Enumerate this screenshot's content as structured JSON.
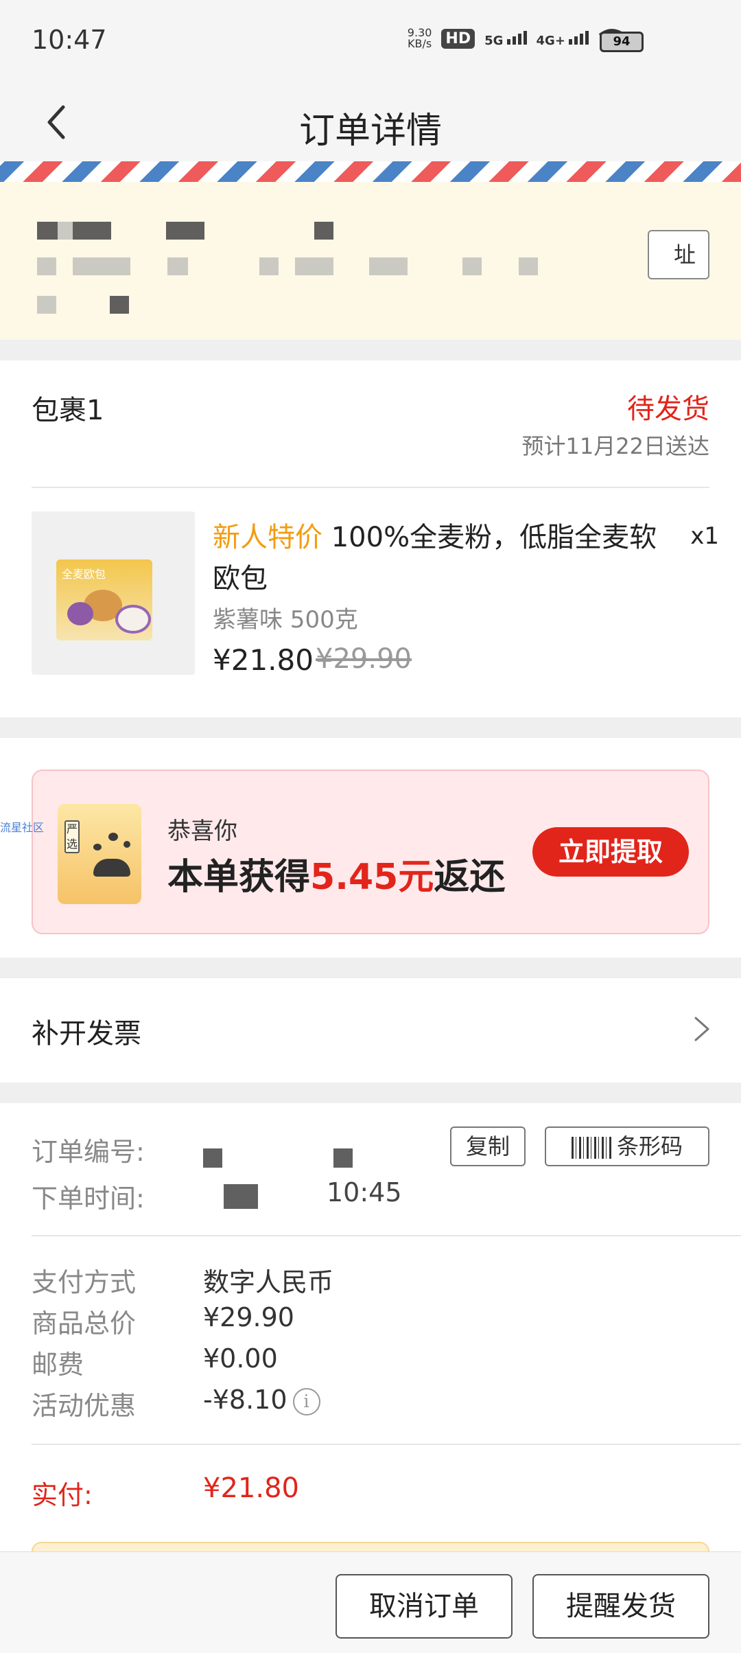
{
  "status_bar": {
    "time": "10:47",
    "speed_value": "9.30",
    "speed_unit": "KB/s",
    "hd": "HD",
    "net_5g": "5G",
    "net_4g": "4G+",
    "battery": "94",
    "icons": [
      "hd-icon",
      "signal-5g-icon",
      "signal-4g-icon",
      "wifi-icon",
      "battery-icon"
    ]
  },
  "nav": {
    "title": "订单详情",
    "back_icon": "chevron-left-icon"
  },
  "address": {
    "button_label": "址"
  },
  "package": {
    "title": "包裹1",
    "status": "待发货",
    "eta": "预计11月22日送达",
    "status_color": "#e1251b"
  },
  "product": {
    "tag": "新人特价",
    "name": "100%全麦粉，低脂全麦软欧包",
    "quantity": "x1",
    "spec": "紫薯味 500克",
    "price": "¥21.80",
    "original_price": "¥29.90",
    "image_text": "全麦欧包"
  },
  "promo": {
    "greeting": "恭喜你",
    "main_prefix": "本单获得",
    "amount": "5.45元",
    "main_suffix": "返还",
    "button_label": "立即提取",
    "logo_text": "严选",
    "side_watermark": "流星社区"
  },
  "invoice": {
    "label": "补开发票"
  },
  "order_info": {
    "order_no_label": "订单编号:",
    "order_time_label": "下单时间:",
    "order_time_value": "10:45",
    "copy_label": "复制",
    "barcode_label": "条形码"
  },
  "payment": {
    "rows": [
      {
        "label": "支付方式",
        "value": "数字人民币"
      },
      {
        "label": "商品总价",
        "value": "¥29.90"
      },
      {
        "label": "邮费",
        "value": "¥0.00"
      },
      {
        "label": "活动优惠",
        "value": "-¥8.10"
      }
    ],
    "info_icon": "i",
    "paid_label": "实付:",
    "paid_value": "¥21.80"
  },
  "bottom": {
    "cancel_label": "取消订单",
    "remind_label": "提醒发货"
  }
}
